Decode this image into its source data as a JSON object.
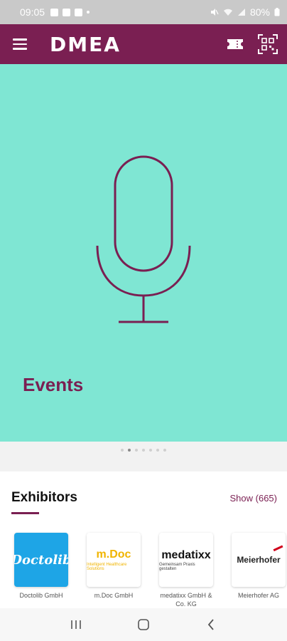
{
  "status_bar": {
    "time": "09:05",
    "battery": "80%"
  },
  "app_bar": {
    "logo": "DMEA",
    "icons": [
      "menu-icon",
      "ticket-icon",
      "qr-code-icon"
    ]
  },
  "hero": {
    "title": "Events",
    "icon": "microphone-icon",
    "background_color": "#7fe6d3",
    "accent_color": "#7a1f52"
  },
  "pager": {
    "count": 7,
    "active_index": 1
  },
  "exhibitors": {
    "title": "Exhibitors",
    "show_label": "Show (665)",
    "items": [
      {
        "logo_text": "Doctolib",
        "logo_sub": "",
        "name": "Doctolib GmbH"
      },
      {
        "logo_text": "m.Doc",
        "logo_sub": "Intelligent Healthcare Solutions",
        "name": "m.Doc GmbH"
      },
      {
        "logo_text": "medatixx",
        "logo_sub": "Gemeinsam Praxis gestalten",
        "name": "medatixx GmbH & Co. KG"
      },
      {
        "logo_text": "Meierhofer",
        "logo_sub": "",
        "name": "Meierhofer AG"
      }
    ]
  },
  "nav_bar": {
    "icons": [
      "recent-apps-icon",
      "home-icon",
      "back-icon"
    ]
  }
}
